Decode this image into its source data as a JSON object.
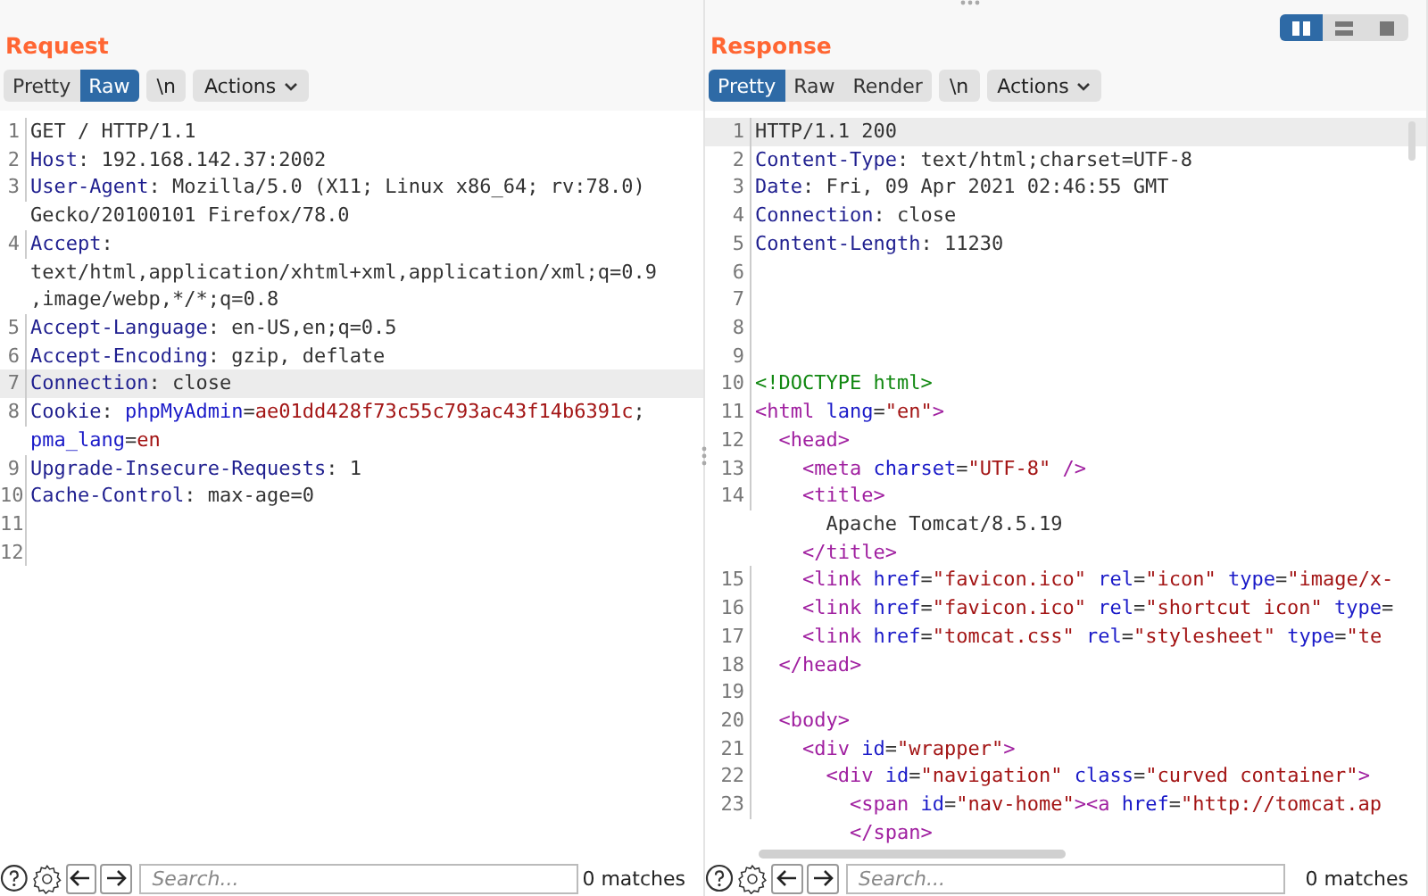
{
  "layout_buttons": [
    {
      "selected": true
    },
    {
      "selected": false
    },
    {
      "selected": false
    }
  ],
  "panels": [
    {
      "title": "Request",
      "view_tabs": [
        {
          "label": "Pretty",
          "selected": false
        },
        {
          "label": "Raw",
          "selected": true
        }
      ],
      "newline_button": "\\n",
      "actions_button": "Actions",
      "lines": [
        {
          "number": "1",
          "highlighted": false,
          "rows": [
            {
              "tokens": [
                {
                  "kind": "text",
                  "text": "GET / HTTP/1.1"
                }
              ]
            }
          ]
        },
        {
          "number": "2",
          "highlighted": false,
          "rows": [
            {
              "tokens": [
                {
                  "kind": "key",
                  "text": "Host"
                },
                {
                  "kind": "text",
                  "text": ": 192.168.142.37:2002"
                }
              ]
            }
          ]
        },
        {
          "number": "3",
          "highlighted": false,
          "rows": [
            {
              "tokens": [
                {
                  "kind": "key",
                  "text": "User-Agent"
                },
                {
                  "kind": "text",
                  "text": ": Mozilla/5.0 (X11; Linux x86_64; rv:78.0)"
                }
              ]
            },
            {
              "tokens": [
                {
                  "kind": "text",
                  "text": "Gecko/20100101 Firefox/78.0"
                }
              ]
            }
          ]
        },
        {
          "number": "4",
          "highlighted": false,
          "rows": [
            {
              "tokens": [
                {
                  "kind": "key",
                  "text": "Accept"
                },
                {
                  "kind": "text",
                  "text": ":"
                }
              ]
            },
            {
              "tokens": [
                {
                  "kind": "text",
                  "text": "text/html,application/xhtml+xml,application/xml;q=0.9"
                }
              ]
            },
            {
              "tokens": [
                {
                  "kind": "text",
                  "text": ",image/webp,*/*;q=0.8"
                }
              ]
            }
          ]
        },
        {
          "number": "5",
          "highlighted": false,
          "rows": [
            {
              "tokens": [
                {
                  "kind": "key",
                  "text": "Accept-Language"
                },
                {
                  "kind": "text",
                  "text": ": en-US,en;q=0.5"
                }
              ]
            }
          ]
        },
        {
          "number": "6",
          "highlighted": false,
          "rows": [
            {
              "tokens": [
                {
                  "kind": "key",
                  "text": "Accept-Encoding"
                },
                {
                  "kind": "text",
                  "text": ": gzip, deflate"
                }
              ]
            }
          ]
        },
        {
          "number": "7",
          "highlighted": true,
          "rows": [
            {
              "tokens": [
                {
                  "kind": "key",
                  "text": "Connection"
                },
                {
                  "kind": "text",
                  "text": ": close"
                }
              ]
            }
          ]
        },
        {
          "number": "8",
          "highlighted": false,
          "rows": [
            {
              "tokens": [
                {
                  "kind": "key",
                  "text": "Cookie"
                },
                {
                  "kind": "text",
                  "text": ": "
                },
                {
                  "kind": "attr",
                  "text": "phpMyAdmin"
                },
                {
                  "kind": "text",
                  "text": "="
                },
                {
                  "kind": "str",
                  "text": "ae01dd428f73c55c793ac43f14b6391c"
                },
                {
                  "kind": "text",
                  "text": ";"
                }
              ]
            },
            {
              "tokens": [
                {
                  "kind": "attr",
                  "text": "pma_lang"
                },
                {
                  "kind": "text",
                  "text": "="
                },
                {
                  "kind": "str",
                  "text": "en"
                }
              ]
            }
          ]
        },
        {
          "number": "9",
          "highlighted": false,
          "rows": [
            {
              "tokens": [
                {
                  "kind": "key",
                  "text": "Upgrade-Insecure-Requests"
                },
                {
                  "kind": "text",
                  "text": ": 1"
                }
              ]
            }
          ]
        },
        {
          "number": "10",
          "highlighted": false,
          "rows": [
            {
              "tokens": [
                {
                  "kind": "key",
                  "text": "Cache-Control"
                },
                {
                  "kind": "text",
                  "text": ": max-age=0"
                }
              ]
            }
          ]
        },
        {
          "number": "11",
          "highlighted": false
        },
        {
          "number": "12",
          "highlighted": false
        }
      ],
      "search": {
        "placeholder": "Search..."
      },
      "matches": "0 matches"
    },
    {
      "title": "Response",
      "view_tabs": [
        {
          "label": "Pretty",
          "selected": true
        },
        {
          "label": "Raw",
          "selected": false
        },
        {
          "label": "Render",
          "selected": false
        }
      ],
      "newline_button": "\\n",
      "actions_button": "Actions",
      "lines": [
        {
          "number": "1",
          "highlighted": true,
          "rows": [
            {
              "tokens": [
                {
                  "kind": "text",
                  "text": "HTTP/1.1 200"
                }
              ]
            }
          ]
        },
        {
          "number": "2",
          "highlighted": false,
          "rows": [
            {
              "tokens": [
                {
                  "kind": "key",
                  "text": "Content-Type"
                },
                {
                  "kind": "text",
                  "text": ": text/html;charset=UTF-8"
                }
              ]
            }
          ]
        },
        {
          "number": "3",
          "highlighted": false,
          "rows": [
            {
              "tokens": [
                {
                  "kind": "key",
                  "text": "Date"
                },
                {
                  "kind": "text",
                  "text": ": Fri, 09 Apr 2021 02:46:55 GMT"
                }
              ]
            }
          ]
        },
        {
          "number": "4",
          "highlighted": false,
          "rows": [
            {
              "tokens": [
                {
                  "kind": "key",
                  "text": "Connection"
                },
                {
                  "kind": "text",
                  "text": ": close"
                }
              ]
            }
          ]
        },
        {
          "number": "5",
          "highlighted": false,
          "rows": [
            {
              "tokens": [
                {
                  "kind": "key",
                  "text": "Content-Length"
                },
                {
                  "kind": "text",
                  "text": ": 11230"
                }
              ]
            }
          ]
        },
        {
          "number": "6",
          "highlighted": false
        },
        {
          "number": "7",
          "highlighted": false
        },
        {
          "number": "8",
          "highlighted": false
        },
        {
          "number": "9",
          "highlighted": false
        },
        {
          "number": "10",
          "highlighted": false,
          "rows": [
            {
              "tokens": [
                {
                  "kind": "doctype",
                  "text": "<!DOCTYPE html>"
                }
              ]
            }
          ]
        },
        {
          "number": "11",
          "highlighted": false,
          "rows": [
            {
              "tokens": [
                {
                  "kind": "tag",
                  "text": "<html "
                },
                {
                  "kind": "attr",
                  "text": "lang"
                },
                {
                  "kind": "text",
                  "text": "="
                },
                {
                  "kind": "str",
                  "text": "\"en\""
                },
                {
                  "kind": "tag",
                  "text": ">"
                }
              ]
            }
          ]
        },
        {
          "number": "12",
          "highlighted": false,
          "rows": [
            {
              "tokens": [
                {
                  "kind": "tag",
                  "text": "  <head>"
                }
              ]
            }
          ]
        },
        {
          "number": "13",
          "highlighted": false,
          "rows": [
            {
              "tokens": [
                {
                  "kind": "tag",
                  "text": "    <meta "
                },
                {
                  "kind": "attr",
                  "text": "charset"
                },
                {
                  "kind": "text",
                  "text": "="
                },
                {
                  "kind": "str",
                  "text": "\"UTF-8\""
                },
                {
                  "kind": "tag",
                  "text": " />"
                }
              ]
            }
          ]
        },
        {
          "number": "14",
          "highlighted": false,
          "rows": [
            {
              "tokens": [
                {
                  "kind": "tag",
                  "text": "    <title>"
                }
              ]
            },
            {
              "tokens": [
                {
                  "kind": "text",
                  "text": "      Apache Tomcat/8.5.19"
                }
              ]
            },
            {
              "tokens": [
                {
                  "kind": "tag",
                  "text": "    </title>"
                }
              ]
            }
          ]
        },
        {
          "number": "15",
          "highlighted": false,
          "rows": [
            {
              "tokens": [
                {
                  "kind": "tag",
                  "text": "    <link "
                },
                {
                  "kind": "attr",
                  "text": "href"
                },
                {
                  "kind": "text",
                  "text": "="
                },
                {
                  "kind": "str",
                  "text": "\"favicon.ico\""
                },
                {
                  "kind": "attr",
                  "text": " rel"
                },
                {
                  "kind": "text",
                  "text": "="
                },
                {
                  "kind": "str",
                  "text": "\"icon\""
                },
                {
                  "kind": "attr",
                  "text": " type"
                },
                {
                  "kind": "text",
                  "text": "="
                },
                {
                  "kind": "str",
                  "text": "\"image/x-"
                }
              ]
            }
          ]
        },
        {
          "number": "16",
          "highlighted": false,
          "rows": [
            {
              "tokens": [
                {
                  "kind": "tag",
                  "text": "    <link "
                },
                {
                  "kind": "attr",
                  "text": "href"
                },
                {
                  "kind": "text",
                  "text": "="
                },
                {
                  "kind": "str",
                  "text": "\"favicon.ico\""
                },
                {
                  "kind": "attr",
                  "text": " rel"
                },
                {
                  "kind": "text",
                  "text": "="
                },
                {
                  "kind": "str",
                  "text": "\"shortcut icon\""
                },
                {
                  "kind": "attr",
                  "text": " type"
                },
                {
                  "kind": "text",
                  "text": "="
                }
              ]
            }
          ]
        },
        {
          "number": "17",
          "highlighted": false,
          "rows": [
            {
              "tokens": [
                {
                  "kind": "tag",
                  "text": "    <link "
                },
                {
                  "kind": "attr",
                  "text": "href"
                },
                {
                  "kind": "text",
                  "text": "="
                },
                {
                  "kind": "str",
                  "text": "\"tomcat.css\""
                },
                {
                  "kind": "attr",
                  "text": " rel"
                },
                {
                  "kind": "text",
                  "text": "="
                },
                {
                  "kind": "str",
                  "text": "\"stylesheet\""
                },
                {
                  "kind": "attr",
                  "text": " type"
                },
                {
                  "kind": "text",
                  "text": "="
                },
                {
                  "kind": "str",
                  "text": "\"te"
                }
              ]
            }
          ]
        },
        {
          "number": "18",
          "highlighted": false,
          "rows": [
            {
              "tokens": [
                {
                  "kind": "tag",
                  "text": "  </head>"
                }
              ]
            }
          ]
        },
        {
          "number": "19",
          "highlighted": false
        },
        {
          "number": "20",
          "highlighted": false,
          "rows": [
            {
              "tokens": [
                {
                  "kind": "tag",
                  "text": "  <body>"
                }
              ]
            }
          ]
        },
        {
          "number": "21",
          "highlighted": false,
          "rows": [
            {
              "tokens": [
                {
                  "kind": "tag",
                  "text": "    <div "
                },
                {
                  "kind": "attr",
                  "text": "id"
                },
                {
                  "kind": "text",
                  "text": "="
                },
                {
                  "kind": "str",
                  "text": "\"wrapper\""
                },
                {
                  "kind": "tag",
                  "text": ">"
                }
              ]
            }
          ]
        },
        {
          "number": "22",
          "highlighted": false,
          "rows": [
            {
              "tokens": [
                {
                  "kind": "tag",
                  "text": "      <div "
                },
                {
                  "kind": "attr",
                  "text": "id"
                },
                {
                  "kind": "text",
                  "text": "="
                },
                {
                  "kind": "str",
                  "text": "\"navigation\""
                },
                {
                  "kind": "attr",
                  "text": " class"
                },
                {
                  "kind": "text",
                  "text": "="
                },
                {
                  "kind": "str",
                  "text": "\"curved container\""
                },
                {
                  "kind": "tag",
                  "text": ">"
                }
              ]
            }
          ]
        },
        {
          "number": "23",
          "highlighted": false,
          "rows": [
            {
              "tokens": [
                {
                  "kind": "tag",
                  "text": "        <span "
                },
                {
                  "kind": "attr",
                  "text": "id"
                },
                {
                  "kind": "text",
                  "text": "="
                },
                {
                  "kind": "str",
                  "text": "\"nav-home\""
                },
                {
                  "kind": "tag",
                  "text": "><a "
                },
                {
                  "kind": "attr",
                  "text": "href"
                },
                {
                  "kind": "text",
                  "text": "="
                },
                {
                  "kind": "str",
                  "text": "\"http://tomcat.ap"
                }
              ]
            },
            {
              "tokens": [
                {
                  "kind": "tag",
                  "text": "        </span>"
                }
              ]
            }
          ]
        }
      ],
      "search": {
        "placeholder": "Search..."
      },
      "matches": "0 matches"
    }
  ]
}
